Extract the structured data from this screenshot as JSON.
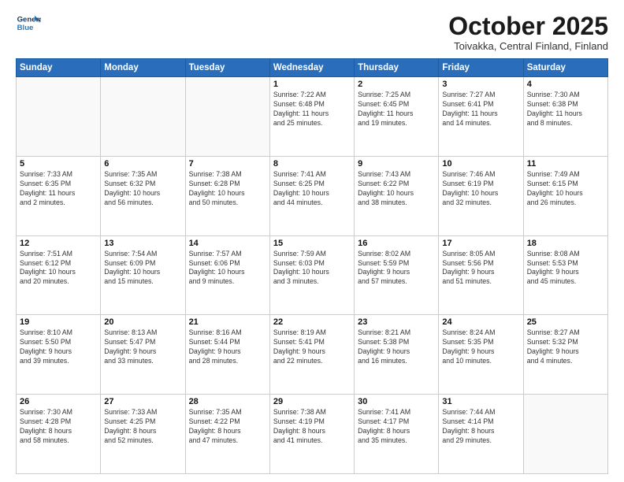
{
  "header": {
    "logo_line1": "General",
    "logo_line2": "Blue",
    "title": "October 2025",
    "subtitle": "Toivakka, Central Finland, Finland"
  },
  "days_of_week": [
    "Sunday",
    "Monday",
    "Tuesday",
    "Wednesday",
    "Thursday",
    "Friday",
    "Saturday"
  ],
  "weeks": [
    [
      {
        "day": "",
        "text": ""
      },
      {
        "day": "",
        "text": ""
      },
      {
        "day": "",
        "text": ""
      },
      {
        "day": "1",
        "text": "Sunrise: 7:22 AM\nSunset: 6:48 PM\nDaylight: 11 hours\nand 25 minutes."
      },
      {
        "day": "2",
        "text": "Sunrise: 7:25 AM\nSunset: 6:45 PM\nDaylight: 11 hours\nand 19 minutes."
      },
      {
        "day": "3",
        "text": "Sunrise: 7:27 AM\nSunset: 6:41 PM\nDaylight: 11 hours\nand 14 minutes."
      },
      {
        "day": "4",
        "text": "Sunrise: 7:30 AM\nSunset: 6:38 PM\nDaylight: 11 hours\nand 8 minutes."
      }
    ],
    [
      {
        "day": "5",
        "text": "Sunrise: 7:33 AM\nSunset: 6:35 PM\nDaylight: 11 hours\nand 2 minutes."
      },
      {
        "day": "6",
        "text": "Sunrise: 7:35 AM\nSunset: 6:32 PM\nDaylight: 10 hours\nand 56 minutes."
      },
      {
        "day": "7",
        "text": "Sunrise: 7:38 AM\nSunset: 6:28 PM\nDaylight: 10 hours\nand 50 minutes."
      },
      {
        "day": "8",
        "text": "Sunrise: 7:41 AM\nSunset: 6:25 PM\nDaylight: 10 hours\nand 44 minutes."
      },
      {
        "day": "9",
        "text": "Sunrise: 7:43 AM\nSunset: 6:22 PM\nDaylight: 10 hours\nand 38 minutes."
      },
      {
        "day": "10",
        "text": "Sunrise: 7:46 AM\nSunset: 6:19 PM\nDaylight: 10 hours\nand 32 minutes."
      },
      {
        "day": "11",
        "text": "Sunrise: 7:49 AM\nSunset: 6:15 PM\nDaylight: 10 hours\nand 26 minutes."
      }
    ],
    [
      {
        "day": "12",
        "text": "Sunrise: 7:51 AM\nSunset: 6:12 PM\nDaylight: 10 hours\nand 20 minutes."
      },
      {
        "day": "13",
        "text": "Sunrise: 7:54 AM\nSunset: 6:09 PM\nDaylight: 10 hours\nand 15 minutes."
      },
      {
        "day": "14",
        "text": "Sunrise: 7:57 AM\nSunset: 6:06 PM\nDaylight: 10 hours\nand 9 minutes."
      },
      {
        "day": "15",
        "text": "Sunrise: 7:59 AM\nSunset: 6:03 PM\nDaylight: 10 hours\nand 3 minutes."
      },
      {
        "day": "16",
        "text": "Sunrise: 8:02 AM\nSunset: 5:59 PM\nDaylight: 9 hours\nand 57 minutes."
      },
      {
        "day": "17",
        "text": "Sunrise: 8:05 AM\nSunset: 5:56 PM\nDaylight: 9 hours\nand 51 minutes."
      },
      {
        "day": "18",
        "text": "Sunrise: 8:08 AM\nSunset: 5:53 PM\nDaylight: 9 hours\nand 45 minutes."
      }
    ],
    [
      {
        "day": "19",
        "text": "Sunrise: 8:10 AM\nSunset: 5:50 PM\nDaylight: 9 hours\nand 39 minutes."
      },
      {
        "day": "20",
        "text": "Sunrise: 8:13 AM\nSunset: 5:47 PM\nDaylight: 9 hours\nand 33 minutes."
      },
      {
        "day": "21",
        "text": "Sunrise: 8:16 AM\nSunset: 5:44 PM\nDaylight: 9 hours\nand 28 minutes."
      },
      {
        "day": "22",
        "text": "Sunrise: 8:19 AM\nSunset: 5:41 PM\nDaylight: 9 hours\nand 22 minutes."
      },
      {
        "day": "23",
        "text": "Sunrise: 8:21 AM\nSunset: 5:38 PM\nDaylight: 9 hours\nand 16 minutes."
      },
      {
        "day": "24",
        "text": "Sunrise: 8:24 AM\nSunset: 5:35 PM\nDaylight: 9 hours\nand 10 minutes."
      },
      {
        "day": "25",
        "text": "Sunrise: 8:27 AM\nSunset: 5:32 PM\nDaylight: 9 hours\nand 4 minutes."
      }
    ],
    [
      {
        "day": "26",
        "text": "Sunrise: 7:30 AM\nSunset: 4:28 PM\nDaylight: 8 hours\nand 58 minutes."
      },
      {
        "day": "27",
        "text": "Sunrise: 7:33 AM\nSunset: 4:25 PM\nDaylight: 8 hours\nand 52 minutes."
      },
      {
        "day": "28",
        "text": "Sunrise: 7:35 AM\nSunset: 4:22 PM\nDaylight: 8 hours\nand 47 minutes."
      },
      {
        "day": "29",
        "text": "Sunrise: 7:38 AM\nSunset: 4:19 PM\nDaylight: 8 hours\nand 41 minutes."
      },
      {
        "day": "30",
        "text": "Sunrise: 7:41 AM\nSunset: 4:17 PM\nDaylight: 8 hours\nand 35 minutes."
      },
      {
        "day": "31",
        "text": "Sunrise: 7:44 AM\nSunset: 4:14 PM\nDaylight: 8 hours\nand 29 minutes."
      },
      {
        "day": "",
        "text": ""
      }
    ]
  ]
}
